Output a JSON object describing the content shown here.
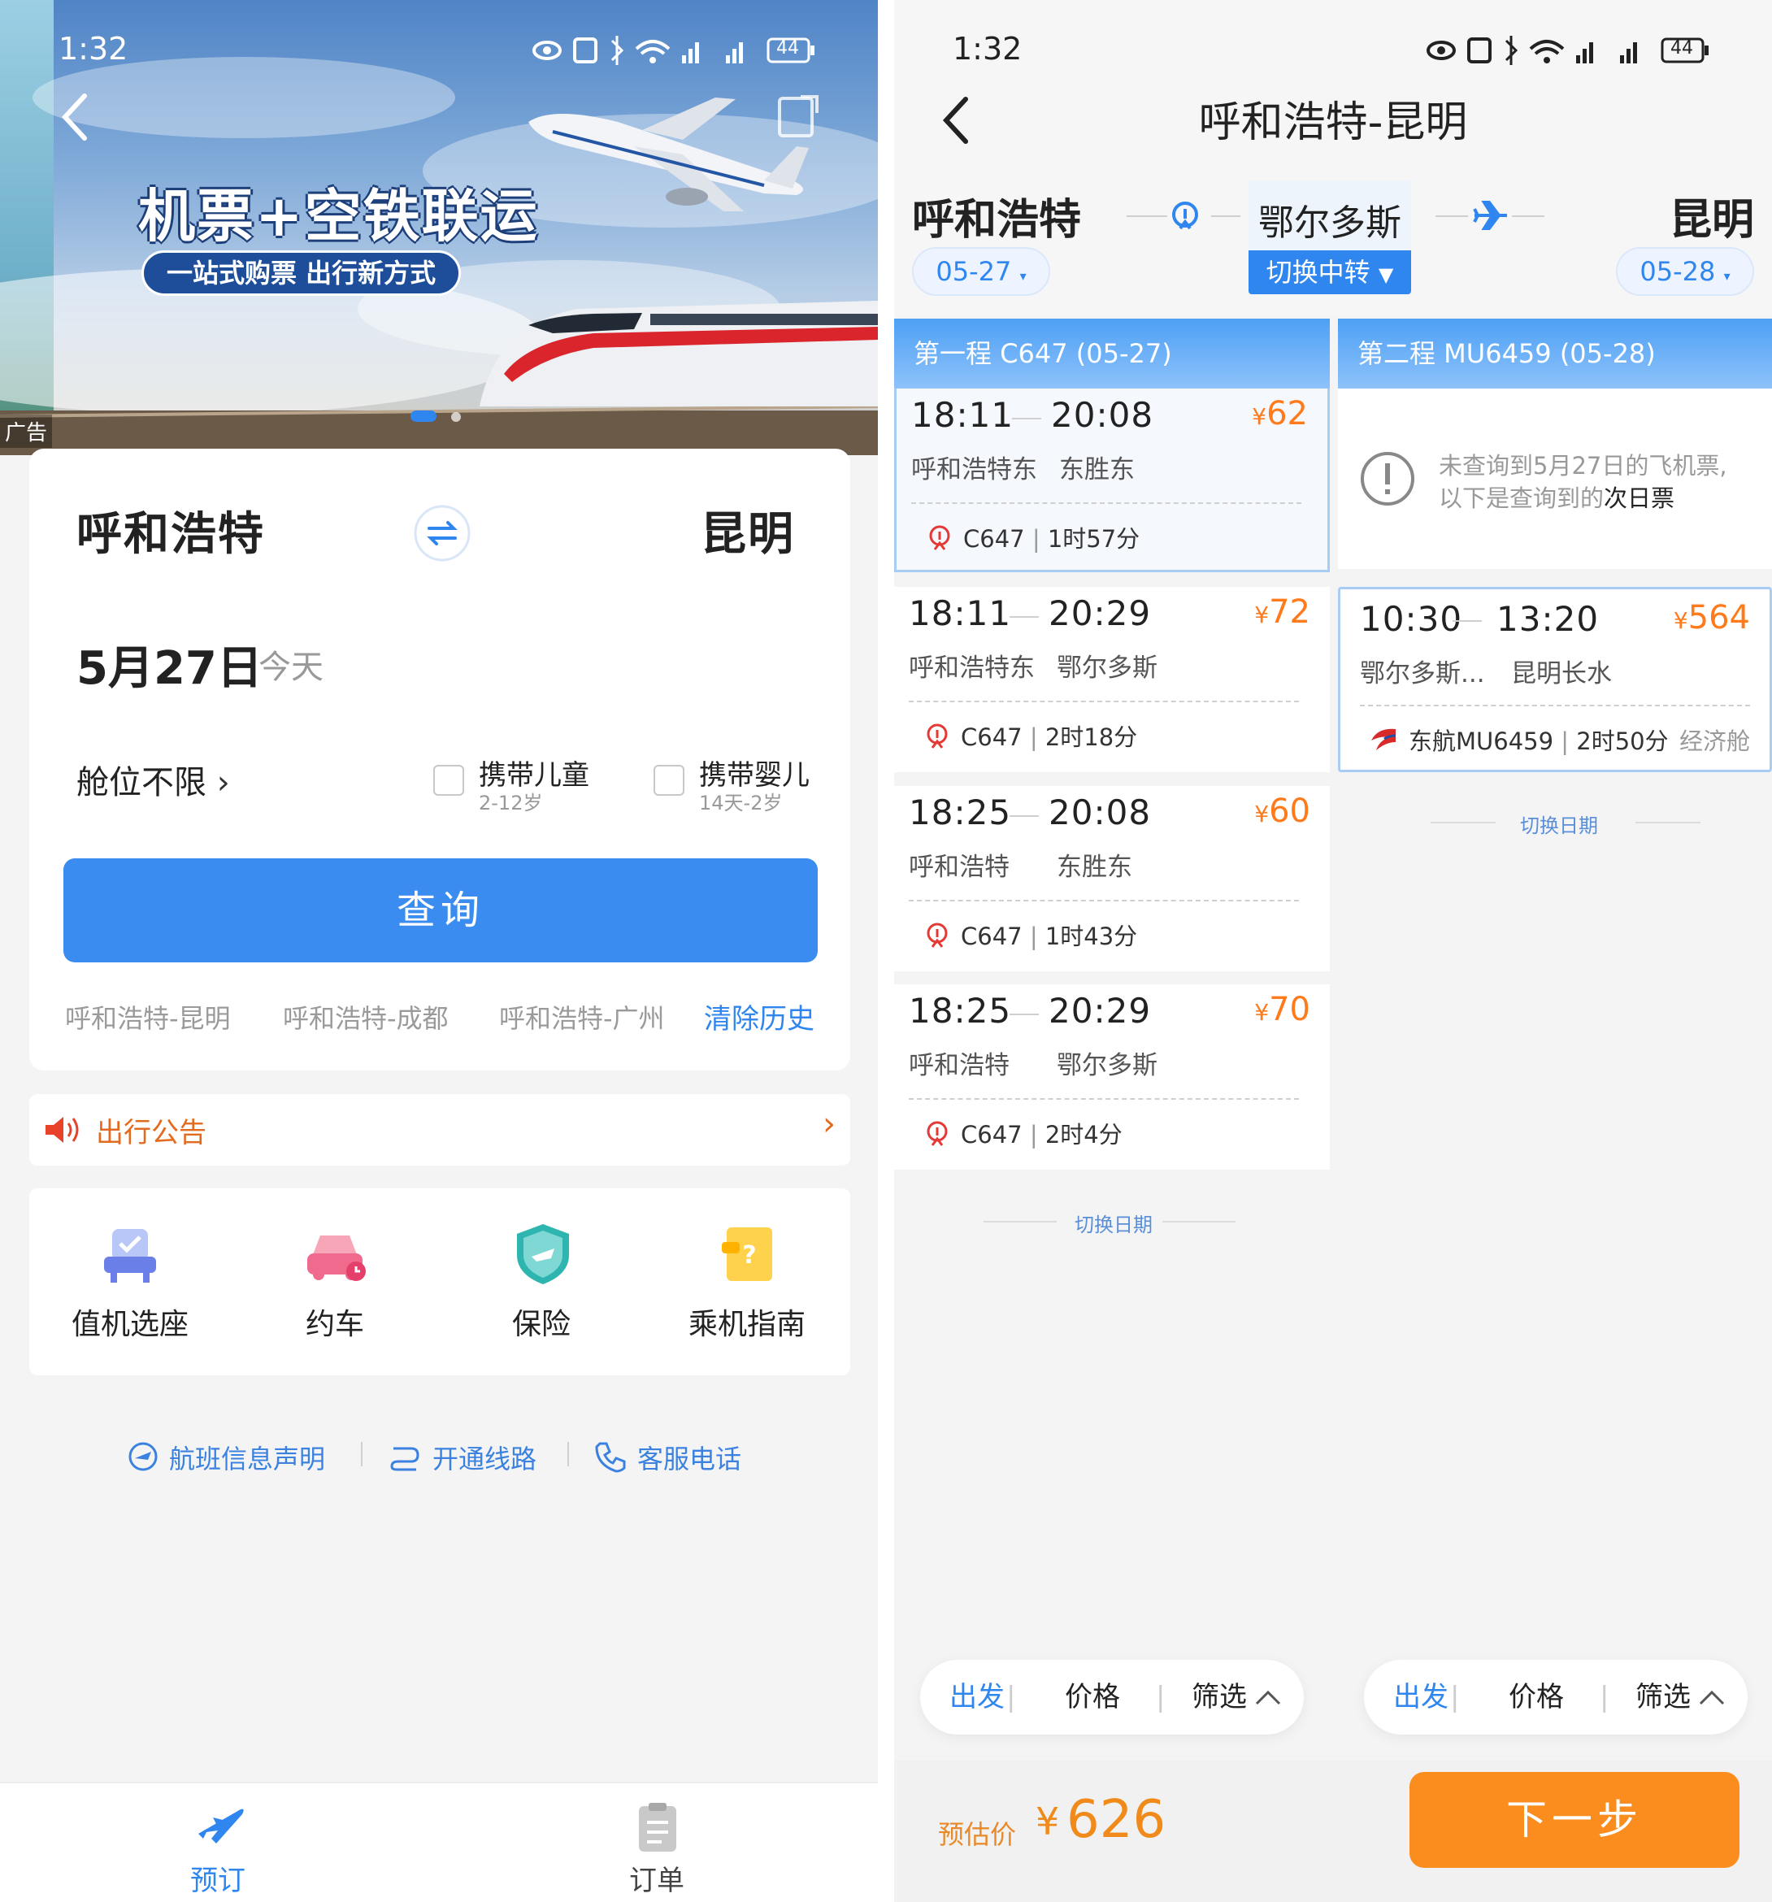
{
  "status_bar": {
    "time": "1:32",
    "battery": "44"
  },
  "left": {
    "banner": {
      "title": "机票+空铁联运",
      "subtitle": "一站式购票 出行新方式",
      "ad_label": "广告"
    },
    "search": {
      "from_city": "呼和浩特",
      "to_city": "昆明",
      "date": "5月27日",
      "date_tag": "今天",
      "cabin": "舱位不限",
      "child_label": "携带儿童",
      "child_age": "2-12岁",
      "infant_label": "携带婴儿",
      "infant_age": "14天-2岁",
      "query_button": "查询",
      "history": [
        "呼和浩特-昆明",
        "呼和浩特-成都",
        "呼和浩特-广州"
      ],
      "clear_history": "清除历史"
    },
    "notice": "出行公告",
    "services": [
      {
        "label": "值机选座",
        "icon": "seat-icon"
      },
      {
        "label": "约车",
        "icon": "car-icon"
      },
      {
        "label": "保险",
        "icon": "insurance-icon"
      },
      {
        "label": "乘机指南",
        "icon": "guide-icon"
      }
    ],
    "footer_links": [
      "航班信息声明",
      "开通线路",
      "客服电话"
    ],
    "tabs": {
      "book": "预订",
      "orders": "订单"
    }
  },
  "right": {
    "title": "呼和浩特-昆明",
    "origin": "呼和浩特",
    "transfer": "鄂尔多斯",
    "destination": "昆明",
    "origin_date": "05-27",
    "dest_date": "05-28",
    "switch_transfer": "切换中转",
    "leg1_header": "第一程 C647 (05-27)",
    "leg2_header": "第二程 MU6459 (05-28)",
    "trains": [
      {
        "dep": "18:11",
        "arr": "20:08",
        "price": "62",
        "from": "呼和浩特东",
        "to": "东胜东",
        "no": "C647",
        "duration": "1时57分"
      },
      {
        "dep": "18:11",
        "arr": "20:29",
        "price": "72",
        "from": "呼和浩特东",
        "to": "鄂尔多斯",
        "no": "C647",
        "duration": "2时18分"
      },
      {
        "dep": "18:25",
        "arr": "20:08",
        "price": "60",
        "from": "呼和浩特",
        "to": "东胜东",
        "no": "C647",
        "duration": "1时43分"
      },
      {
        "dep": "18:25",
        "arr": "20:29",
        "price": "70",
        "from": "呼和浩特",
        "to": "鄂尔多斯",
        "no": "C647",
        "duration": "2时4分"
      }
    ],
    "no_flight_notice_1": "未查询到5月27日的飞机票,",
    "no_flight_notice_2a": "以下是查询到的",
    "no_flight_notice_2b": "次日票",
    "flight": {
      "dep": "10:30",
      "arr": "13:20",
      "price": "564",
      "from": "鄂尔多斯...",
      "to": "昆明长水",
      "no": "东航MU6459",
      "duration": "2时50分",
      "cabin": "经济舱"
    },
    "switch_date": "切换日期",
    "sort": {
      "depart": "出发",
      "price": "价格",
      "filter": "筛选"
    },
    "estimate_label": "预估价",
    "currency": "¥",
    "estimate_price": "626",
    "next_button": "下一步"
  }
}
